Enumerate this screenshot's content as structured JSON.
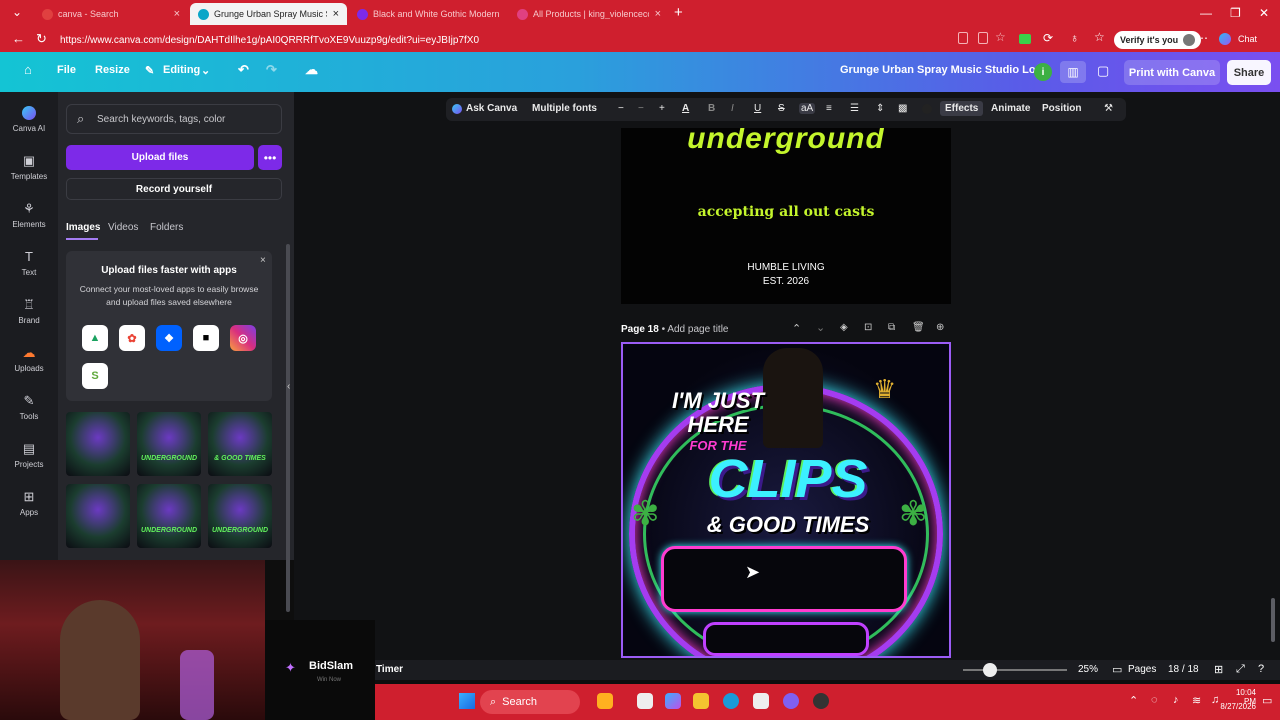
{
  "browser": {
    "tabs": [
      {
        "title": "canva - Search",
        "active": false
      },
      {
        "title": "Grunge Urban Spray Music Studio",
        "active": true
      },
      {
        "title": "Black and White Gothic Modern C",
        "active": false
      },
      {
        "title": "All Products | king_violencecollabs",
        "active": false
      }
    ],
    "new_tab": "+",
    "url": "https://www.canva.com/design/DAHTdIlhe1g/pAI0QRRRfTvoXE9Vuuzp9g/edit?ui=eyJBIjp7fX0",
    "verify_label": "Verify it's you",
    "chat_label": "Chat"
  },
  "canva_header": {
    "file": "File",
    "resize": "Resize",
    "editing": "Editing",
    "design_title": "Grunge Urban Spray Music Studio Logo",
    "print_button": "Print with Canva",
    "share_button": "Share"
  },
  "rail": {
    "items": [
      {
        "label": "Canva AI",
        "icon": "canva-ai-icon"
      },
      {
        "label": "Templates",
        "icon": "templates-icon"
      },
      {
        "label": "Elements",
        "icon": "elements-icon"
      },
      {
        "label": "Text",
        "icon": "text-icon"
      },
      {
        "label": "Brand",
        "icon": "brand-icon"
      },
      {
        "label": "Uploads",
        "icon": "uploads-icon"
      },
      {
        "label": "Tools",
        "icon": "tools-icon"
      },
      {
        "label": "Projects",
        "icon": "projects-icon"
      },
      {
        "label": "Apps",
        "icon": "apps-icon"
      }
    ]
  },
  "panel": {
    "search_placeholder": "Search keywords, tags, color",
    "upload_button": "Upload files",
    "record_button": "Record yourself",
    "tabs": [
      "Images",
      "Videos",
      "Folders"
    ],
    "promo": {
      "title": "Upload files faster with apps",
      "body": "Connect your most-loved apps to easily browse and upload files saved elsewhere"
    },
    "thumbnails": [
      "",
      "UNDERGROUND",
      "& GOOD TIMES",
      "",
      "UNDERGROUND",
      "UNDERGROUND"
    ]
  },
  "toolbar": {
    "ask_canva": "Ask Canva",
    "font": "Multiple fonts",
    "minus": "−",
    "size": "−",
    "plus": "+",
    "effects": "Effects",
    "animate": "Animate",
    "position": "Position"
  },
  "canvas": {
    "page17": {
      "headline": "underground",
      "tagline": "accepting all out casts",
      "line1": "HUMBLE LIVING",
      "line2": "EST. 2026"
    },
    "page18": {
      "label": "Page 18",
      "add_title": "Add page title",
      "art_line1": "I'M JUST",
      "art_line2": "HERE",
      "art_line3": "FOR THE",
      "art_line4": "CLIPS",
      "art_line5": "& GOOD TIMES"
    }
  },
  "bottom_bar": {
    "timer": "Timer",
    "zoom": "25%",
    "pages_label": "Pages",
    "page_count": "18 / 18",
    "zoom_level": 0.25
  },
  "taskbar": {
    "search": "Search",
    "time": "10:04 PM",
    "date": "8/27/2026"
  },
  "overlay": {
    "brand": "BidSlam",
    "brand_sub": "Win Now"
  }
}
